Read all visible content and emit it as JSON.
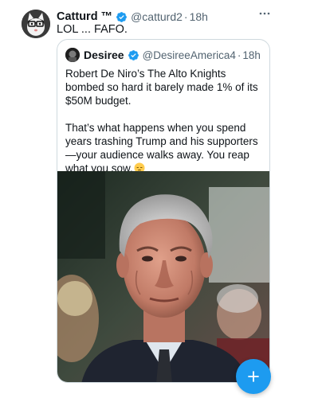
{
  "tweet": {
    "author_name": "Catturd ™",
    "verified_icon": "verified-badge-icon",
    "handle": "@catturd2",
    "separator": "·",
    "time": "18h",
    "more_icon": "more-options-icon",
    "text": "LOL ... FAFO."
  },
  "quote": {
    "author_name": "Desiree",
    "verified_icon": "verified-badge-icon",
    "handle": "@DesireeAmerica4",
    "separator": "·",
    "time": "18h",
    "paragraph_1": "Robert De Niro’s The Alto Knights bombed so hard it barely made 1% of its $50M budget.",
    "paragraph_2": "That’s what happens when you spend years trashing Trump and his supporters—your audience walks away. You reap what you sow.",
    "emoji": "pensive-face-icon",
    "image": "photo of an older man with gray hair in a dark suit"
  },
  "compose_button": {
    "icon": "plus-icon"
  },
  "colors": {
    "accent": "#1d9bf0",
    "text_primary": "#0f1419",
    "text_secondary": "#536471",
    "border": "#cfd9de"
  }
}
